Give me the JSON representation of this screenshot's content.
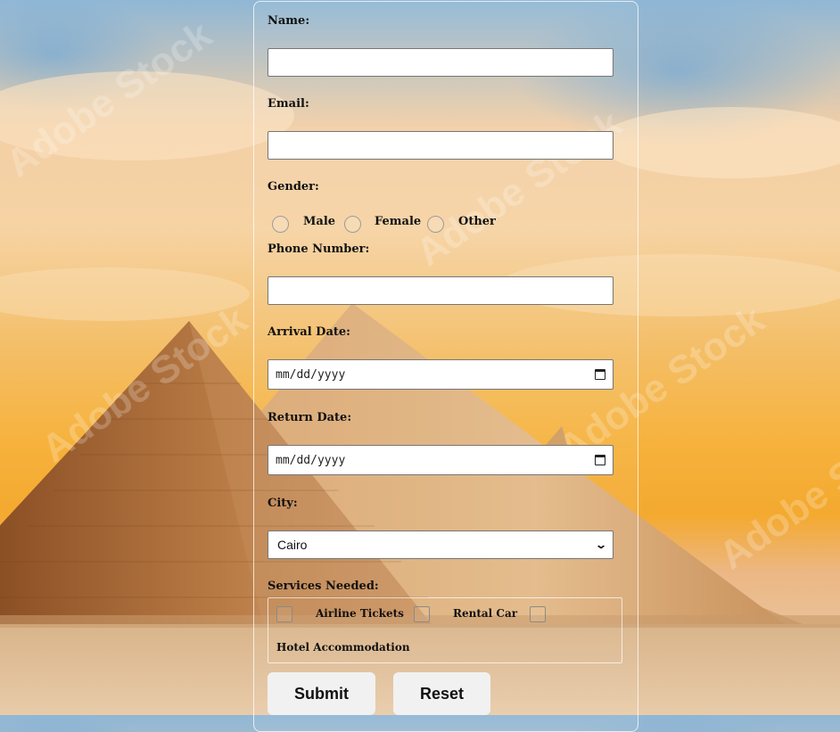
{
  "form": {
    "name_label": "Name:",
    "email_label": "Email:",
    "gender_label": "Gender:",
    "gender_options": [
      "Male",
      "Female",
      "Other"
    ],
    "phone_label": "Phone Number:",
    "arrival_label": "Arrival Date:",
    "arrival_placeholder": "mm/dd/yyyy",
    "return_label": "Return Date:",
    "return_placeholder": "mm/dd/yyyy",
    "city_label": "City:",
    "city_value": "Cairo",
    "services_label": "Services Needed:",
    "services": [
      "Airline Tickets",
      "Rental Car",
      "Hotel Accommodation"
    ],
    "submit_label": "Submit",
    "reset_label": "Reset"
  },
  "background": {
    "watermark": "Adobe Stock"
  },
  "icons": {
    "date_picker": "calendar-icon",
    "select": "chevron-down-icon"
  }
}
